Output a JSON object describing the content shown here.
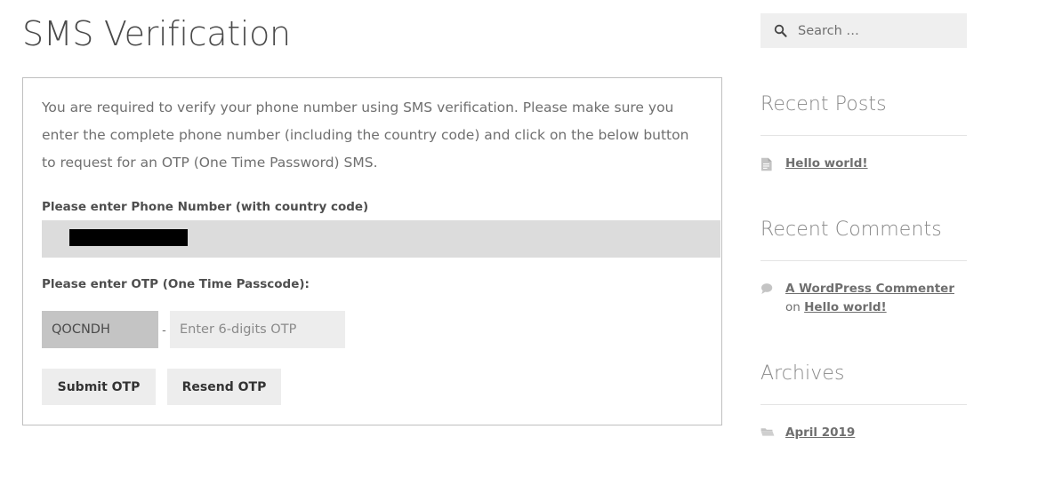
{
  "page": {
    "title": "SMS Verification"
  },
  "form": {
    "intro": "You are required to verify your phone number using SMS verification. Please make sure you enter the complete phone number (including the country code) and click on the below button to request for an OTP (One Time Password) SMS.",
    "phone": {
      "label": "Please enter Phone Number (with country code)",
      "value": "",
      "redacted": true,
      "placeholder": ""
    },
    "otp": {
      "label": "Please enter OTP (One Time Passcode):",
      "prefix": "QOCNDH",
      "separator": "-",
      "placeholder": "Enter 6-digits OTP",
      "value": ""
    },
    "buttons": {
      "submit": "Submit OTP",
      "resend": "Resend OTP"
    }
  },
  "sidebar": {
    "search": {
      "placeholder": "Search …",
      "value": "",
      "icon": "search-icon"
    },
    "widgets": [
      {
        "title": "Recent Posts",
        "items": [
          {
            "icon": "document-icon",
            "link": "Hello world!"
          }
        ]
      },
      {
        "title": "Recent Comments",
        "items": [
          {
            "icon": "comment-icon",
            "link": "A WordPress Commenter",
            "separator": " on ",
            "link2": "Hello world!"
          }
        ]
      },
      {
        "title": "Archives",
        "items": [
          {
            "icon": "folder-icon",
            "link": "April 2019"
          }
        ]
      }
    ]
  },
  "colors": {
    "text": "#444444",
    "muted": "#6f6f6f",
    "heading": "#888888",
    "panel_border": "#bfbfbf",
    "field_bg": "#dcdcdc",
    "prefix_bg": "#c4c4c4",
    "input_bg": "#ededed",
    "redaction": "#000000"
  }
}
